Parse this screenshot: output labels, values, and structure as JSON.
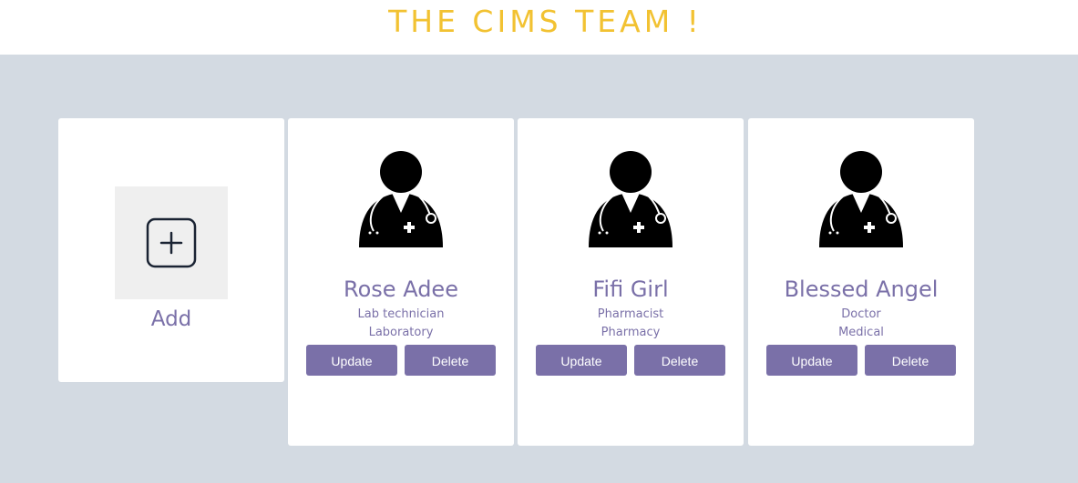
{
  "header": {
    "title": "THE CIMS TEAM !"
  },
  "add_card": {
    "label": "Add",
    "icon": "plus-square-icon"
  },
  "members": [
    {
      "name": "Rose Adee",
      "role": "Lab technician",
      "department": "Laboratory",
      "icon": "doctor-avatar-icon",
      "update_label": "Update",
      "delete_label": "Delete"
    },
    {
      "name": "Fifi Girl",
      "role": "Pharmacist",
      "department": "Pharmacy",
      "icon": "doctor-avatar-icon",
      "update_label": "Update",
      "delete_label": "Delete"
    },
    {
      "name": "Blessed Angel",
      "role": "Doctor",
      "department": "Medical",
      "icon": "doctor-avatar-icon",
      "update_label": "Update",
      "delete_label": "Delete"
    }
  ],
  "colors": {
    "title": "#f2c232",
    "accent": "#7a70a8",
    "background": "#d3dae2",
    "card": "#ffffff",
    "add_box": "#efefef"
  }
}
